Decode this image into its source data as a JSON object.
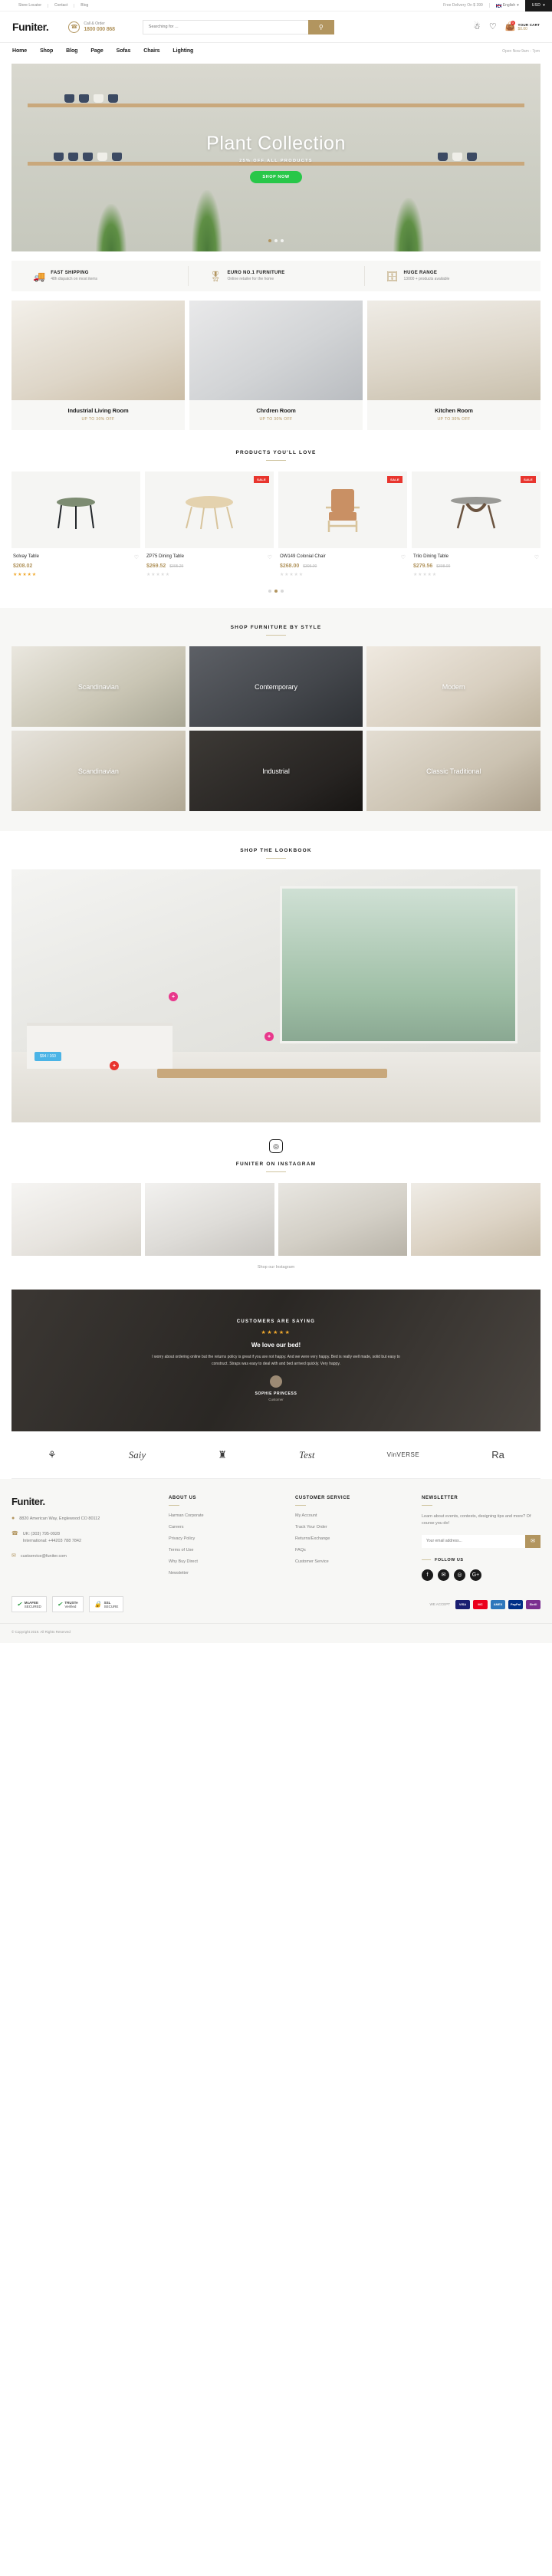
{
  "topbar": {
    "links": [
      "Store Locator",
      "Contact",
      "Blog"
    ],
    "delivery": "Free Delivery On $ 399",
    "language": "English",
    "currency": "USD"
  },
  "header": {
    "logo": "Funiter.",
    "call_label": "Call & Order",
    "phone": "1800 000 868",
    "search_placeholder": "Searching for ...",
    "cart_label": "YOUR CART",
    "cart_total": "$0.00",
    "cart_count": "0"
  },
  "nav": {
    "items": [
      "Home",
      "Shop",
      "Blog",
      "Page",
      "Sofas",
      "Chairs",
      "Lighting"
    ],
    "hours": "Open Now 9am - 7pm"
  },
  "hero": {
    "title": "Plant Collection",
    "subtitle": "25% OFF ALL PRODUCTS",
    "button": "SHOP NOW"
  },
  "features": [
    {
      "icon": "truck-icon",
      "title": "FAST SHIPPING",
      "desc": "48h dispatch on most items"
    },
    {
      "icon": "award-icon",
      "title": "EURO NO.1 FURNITURE",
      "desc": "Online retailer for the home"
    },
    {
      "icon": "drawers-icon",
      "title": "HUGE RANGE",
      "desc": "13000 + products available"
    }
  ],
  "categories": [
    {
      "name": "Industrial Living Room",
      "offer": "UP TO 30% OFF"
    },
    {
      "name": "Chrdren Room",
      "offer": "UP TO 30% OFF"
    },
    {
      "name": "Kitchen Room",
      "offer": "UP TO 30% OFF"
    }
  ],
  "products_section": {
    "title": "PRODUCTS YOU'LL LOVE"
  },
  "products": [
    {
      "name": "Solvay Table",
      "price": "$208.02",
      "old_price": "",
      "sale": false,
      "rating": 5
    },
    {
      "name": "ZP75 Dining Table",
      "price": "$269.52",
      "old_price": "$395.29",
      "sale": true,
      "rating": 0
    },
    {
      "name": "OW149 Colonial Chair",
      "price": "$268.00",
      "old_price": "$395.00",
      "sale": true,
      "rating": 0
    },
    {
      "name": "Trilo Dining Table",
      "price": "$279.56",
      "old_price": "$398.00",
      "sale": true,
      "rating": 0
    }
  ],
  "style_section": {
    "title": "SHOP FURNITURE BY STYLE",
    "cells": [
      "Scandinavian",
      "Contemporary",
      "Modern",
      "Scandinavian",
      "Industrial",
      "Classic Traditional"
    ]
  },
  "lookbook": {
    "title": "SHOP THE LOOKBOOK",
    "tag": "$94 / 160",
    "hotspots": [
      "+",
      "+",
      "+"
    ]
  },
  "instagram": {
    "title": "FUNITER ON INSTAGRAM",
    "icon": "instagram-icon",
    "link": "Shop our Instagram"
  },
  "testimonial": {
    "heading": "CUSTOMERS ARE SAYING",
    "stars": 5,
    "quote": "We love our bed!",
    "body": "I worry about ordering online but the returns policy is great if you are not happy. And we were very happy. Bed is really well made, solid but easy to construct. Straps was easy to deal with and bed arrived quickly. Very happy.",
    "name": "SOPHIE PRINCESS",
    "role": "Customer"
  },
  "brands": [
    "⚘",
    "Saiy",
    "♜",
    "Test",
    "VinVERSE",
    "Rа"
  ],
  "footer": {
    "logo": "Funiter.",
    "address": "8820 American Way, Englewood CO 80112",
    "phone_uk": "UK: (303) 795-0928",
    "phone_intl": "International: +44203 788 7842",
    "email": "custservice@funiter.com",
    "about_title": "ABOUT US",
    "about_links": [
      "Harman Corporate",
      "Careers",
      "Privacy Policy",
      "Terms of Use",
      "Why Buy Direct",
      "Newsletter"
    ],
    "service_title": "CUSTOMER SERVICE",
    "service_links": [
      "My Account",
      "Track Your Order",
      "Returns/Exchange",
      "FAQs",
      "Customer Service"
    ],
    "newsletter_title": "NEWSLETTER",
    "newsletter_desc": "Learn about events, contests, designing tips and more? Of course you do!",
    "newsletter_placeholder": "Your email address...",
    "follow_label": "FOLLOW US",
    "socials": [
      "f",
      "✉",
      "◎",
      "G+"
    ],
    "badges": [
      {
        "top": "McAFEE",
        "bottom": "SECURED"
      },
      {
        "top": "TRUSTe",
        "bottom": "Verified"
      },
      {
        "top": "SSL",
        "bottom": "SECURE"
      }
    ],
    "pay_label": "WE ACCEPT",
    "payments": [
      {
        "name": "VISA",
        "color": "#1a1f71"
      },
      {
        "name": "MC",
        "color": "#eb001b"
      },
      {
        "name": "AMEX",
        "color": "#2e77bc"
      },
      {
        "name": "PayPal",
        "color": "#003087"
      },
      {
        "name": "Skrill",
        "color": "#7a2f8f"
      }
    ],
    "copyright": "© Copyright 2019. All Rights Reserved"
  },
  "colors": {
    "accent": "#b2955f",
    "dark": "#1b1b1b",
    "sale": "#e8352e",
    "green": "#28c749"
  }
}
